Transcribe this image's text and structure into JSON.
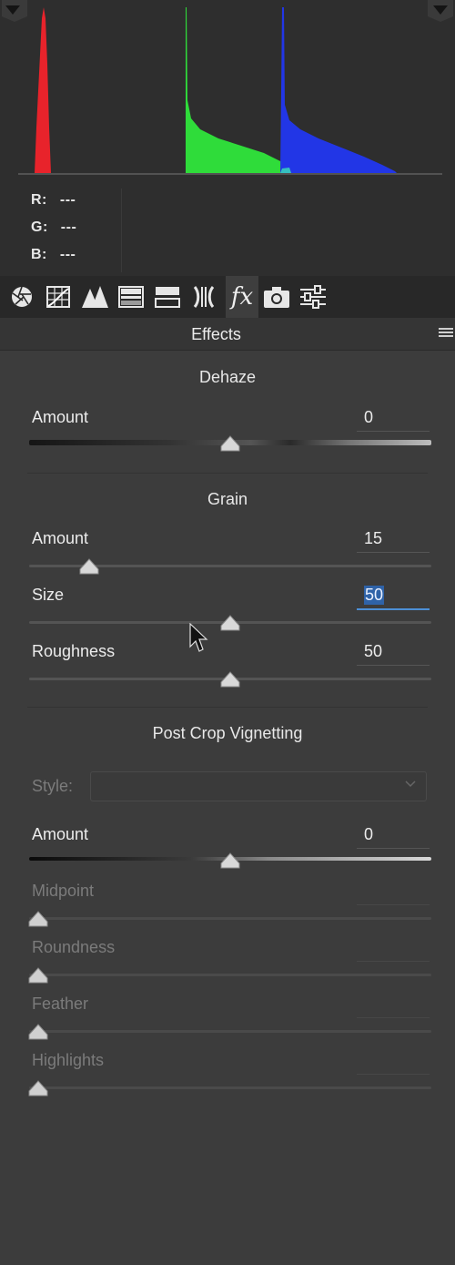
{
  "histogram": {
    "readout": [
      {
        "channel": "R:",
        "value": "---"
      },
      {
        "channel": "G:",
        "value": "---"
      },
      {
        "channel": "B:",
        "value": "---"
      }
    ],
    "colors": {
      "red": "#e8232b",
      "green": "#2fdc3a",
      "blue": "#2236e6"
    }
  },
  "toolbar": {
    "tools": [
      "basic-icon",
      "tone-curve-icon",
      "detail-icon",
      "hsl-icon",
      "split-toning-icon",
      "lens-corrections-icon",
      "fx-icon",
      "camera-calibration-icon",
      "presets-icon"
    ],
    "fx_label": "fx",
    "active": "fx-icon"
  },
  "panel": {
    "title": "Effects"
  },
  "dehaze": {
    "title": "Dehaze",
    "amount": {
      "label": "Amount",
      "value": "0",
      "position": 0.5
    }
  },
  "grain": {
    "title": "Grain",
    "amount": {
      "label": "Amount",
      "value": "15",
      "position": 0.15
    },
    "size": {
      "label": "Size",
      "value": "50",
      "position": 0.5
    },
    "roughness": {
      "label": "Roughness",
      "value": "50",
      "position": 0.5
    }
  },
  "vignetting": {
    "title": "Post Crop Vignetting",
    "style_label": "Style:",
    "amount": {
      "label": "Amount",
      "value": "0",
      "position": 0.5
    },
    "midpoint": {
      "label": "Midpoint",
      "position": 0
    },
    "roundness": {
      "label": "Roundness",
      "position": 0
    },
    "feather": {
      "label": "Feather",
      "position": 0
    },
    "highlights": {
      "label": "Highlights",
      "position": 0
    }
  },
  "colors": {
    "accent": "#4c8fd6",
    "background": "#3c3c3c"
  }
}
